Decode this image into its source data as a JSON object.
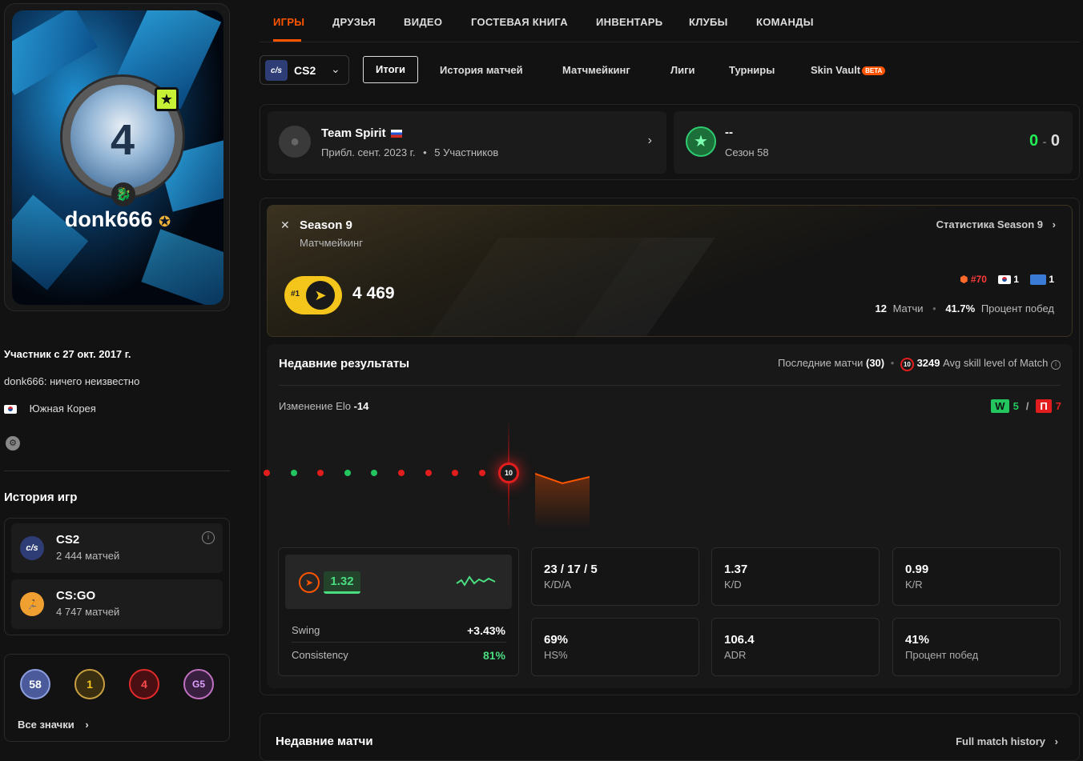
{
  "sidebar": {
    "nickname": "donk666",
    "avatar_number": "4",
    "member_since": "Участник с 27 окт. 2017 г.",
    "bio": "donk666: ничего неизвестно",
    "country": "Южная Корея",
    "history_title": "История игр",
    "games": [
      {
        "name": "CS2",
        "count": "2 444 матчей",
        "icon": "CS"
      },
      {
        "name": "CS:GO",
        "count": "4 747 матчей",
        "icon": "CS:GO"
      }
    ],
    "badges": [
      "58",
      "1",
      "4",
      "G5"
    ],
    "all_badges": "Все значки"
  },
  "nav": {
    "tabs": [
      "ИГРЫ",
      "ДРУЗЬЯ",
      "ВИДЕО",
      "ГОСТЕВАЯ КНИГА",
      "ИНВЕНТАРЬ",
      "КЛУБЫ",
      "КОМАНДЫ"
    ],
    "game": "CS2",
    "subtabs": [
      "Итоги",
      "История матчей",
      "Матчмейкинг",
      "Лиги",
      "Турниры",
      "Skin Vault"
    ],
    "beta": "BETA"
  },
  "team": {
    "name": "Team Spirit",
    "meta_date": "Прибл. сент. 2023 г.",
    "meta_sep": "•",
    "members": "5 Участников"
  },
  "league": {
    "name": "--",
    "season": "Сезон 58",
    "score_left": "0",
    "score_sep": "-",
    "score_right": "0"
  },
  "season": {
    "title": "Season 9",
    "subtitle": "Матчмейкинг",
    "stats_link": "Статистика Season 9",
    "rank": "#1",
    "elo": "4 469",
    "region_rank": "#70",
    "country_rank": "1",
    "extra_rank": "1",
    "matches_value": "12",
    "matches_label": "Матчи",
    "winrate_value": "41.7%",
    "winrate_label": "Процент побед"
  },
  "recent": {
    "title": "Недавние результаты",
    "last_matches_label": "Последние матчи",
    "last_matches_count": "(30)",
    "skill_level": "10",
    "avg_value": "3249",
    "avg_label": "Avg skill level of Match",
    "elo_change_label": "Изменение Elo",
    "elo_change_value": "-14",
    "wins_tag": "W",
    "wins": "5",
    "separator": "/",
    "losses_tag": "П",
    "losses": "7",
    "results": [
      "L",
      "W",
      "L",
      "W",
      "W",
      "L",
      "L",
      "L",
      "L"
    ],
    "current_level": "10"
  },
  "rating": {
    "value": "1.32",
    "swing_label": "Swing",
    "swing_value": "+3.43%",
    "consistency_label": "Consistency",
    "consistency_value": "81%"
  },
  "stats": [
    {
      "value": "23 / 17 / 5",
      "label": "K/D/A"
    },
    {
      "value": "1.37",
      "label": "K/D"
    },
    {
      "value": "0.99",
      "label": "K/R"
    },
    {
      "value": "69%",
      "label": "HS%"
    },
    {
      "value": "106.4",
      "label": "ADR"
    },
    {
      "value": "41%",
      "label": "Процент побед"
    }
  ],
  "recent_matches": {
    "title": "Недавние матчи",
    "full_history": "Full match history"
  },
  "colors": {
    "accent": "#ff5500",
    "win": "#22c55e",
    "loss": "#e11d1d",
    "gold": "#f4c51a"
  }
}
